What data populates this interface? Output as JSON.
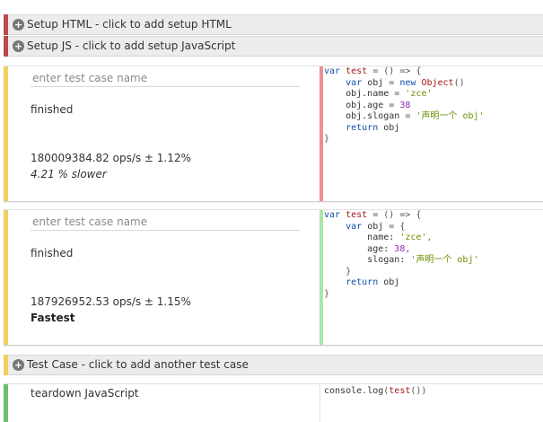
{
  "setup_html": {
    "label": "Setup HTML - click to add setup HTML",
    "accent": "#b94a48"
  },
  "setup_js": {
    "label": "Setup JS - click to add setup JavaScript",
    "accent": "#b94a48"
  },
  "test_cases": [
    {
      "name_placeholder": "enter test case name",
      "status": "finished",
      "ops": "180009384.82 ops/s ± 1.12%",
      "relative": "4.21 % slower",
      "accent": "#f0d060",
      "code_accent": "#ef8f8f",
      "code": {
        "l1": [
          "var",
          "test",
          "= () => {"
        ],
        "l2": [
          "var",
          "obj",
          "=",
          "new",
          "Object",
          "()"
        ],
        "l3": [
          "obj.name",
          "=",
          "'zce'"
        ],
        "l4": [
          "obj.age",
          "=",
          "38"
        ],
        "l5": [
          "obj.slogan",
          "=",
          "'声明一个 obj'"
        ],
        "l6": [
          "return",
          "obj"
        ],
        "l7": "}"
      }
    },
    {
      "name_placeholder": "enter test case name",
      "status": "finished",
      "ops": "187926952.53 ops/s ± 1.15%",
      "relative": "Fastest",
      "accent": "#f0d060",
      "code_accent": "#a8e8a8",
      "code": {
        "l1": [
          "var",
          "test",
          "= () => {"
        ],
        "l2": [
          "var",
          "obj",
          "= {"
        ],
        "l3": [
          "name:",
          "'zce',"
        ],
        "l4": [
          "age:",
          "38,"
        ],
        "l5": [
          "slogan:",
          "'声明一个 obj'"
        ],
        "l6": "}",
        "l7": [
          "return",
          "obj"
        ],
        "l8": "}"
      }
    }
  ],
  "add_test_case": {
    "label": "Test Case - click to add another test case",
    "accent": "#f0d060"
  },
  "teardown": {
    "label": "teardown JavaScript",
    "accent": "#6cc06c",
    "code": [
      "console",
      ".",
      "log",
      "(",
      "test",
      "())"
    ]
  }
}
